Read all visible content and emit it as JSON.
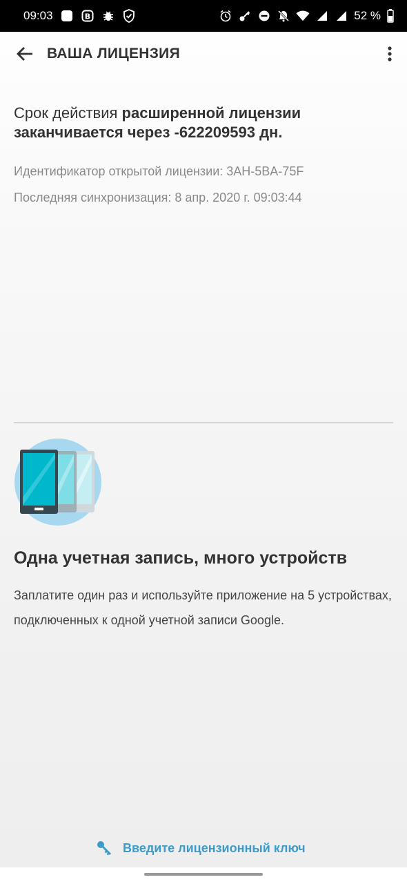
{
  "status_bar": {
    "time": "09:03",
    "battery": "52 %",
    "left_icons": [
      "app-square-icon",
      "b-badge-icon",
      "bug-icon",
      "shield-check-icon"
    ],
    "right_icons": [
      "alarm-icon",
      "key-icon",
      "do-not-disturb-icon",
      "bell-off-icon",
      "wifi-icon",
      "signal-icon",
      "signal-icon",
      "battery-icon"
    ]
  },
  "app_bar": {
    "title": "ВАША ЛИЦЕНЗИЯ",
    "back_icon": "arrow-left-icon",
    "menu_icon": "more-vertical-icon"
  },
  "license": {
    "prefix": "Срок действия ",
    "bold_text": "расширенной лицензии заканчивается через -622209593 дн.",
    "identifier_line": "Идентификатор открытой лицензии: 3AH-5BA-75F",
    "sync_line": "Последняя синхронизация: 8 апр. 2020 г. 09:03:44"
  },
  "feature": {
    "icon": "devices-icon",
    "title": "Одна учетная запись, много устройств",
    "description": "Заплатите один раз и используйте приложение на 5 устройствах, подключенных к одной учетной записи Google."
  },
  "actions": {
    "enter_key_label": "Введите лицензионный ключ",
    "enter_key_icon": "key-icon"
  },
  "colors": {
    "accent": "#3d9bc9",
    "illustration_circle": "#a7d8f0",
    "illustration_screen": "#00b8cc"
  }
}
